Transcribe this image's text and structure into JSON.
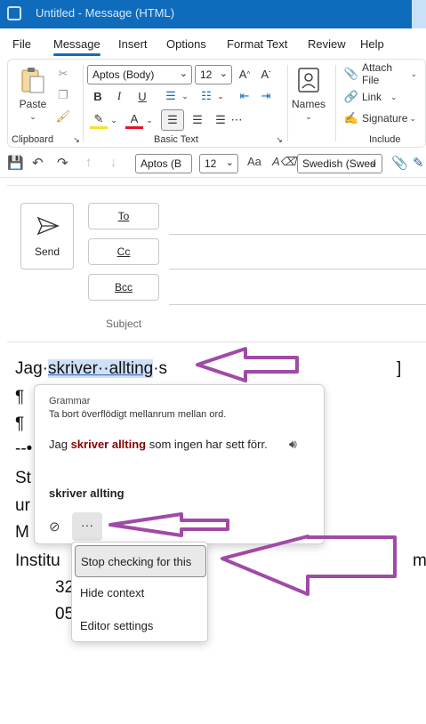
{
  "titlebar": {
    "title": "Untitled  -  Message (HTML)"
  },
  "tabs": [
    "File",
    "Message",
    "Insert",
    "Options",
    "Format Text",
    "Review",
    "Help"
  ],
  "active_tab": "Message",
  "ribbon": {
    "clipboard": {
      "paste": "Paste",
      "label": "Clipboard"
    },
    "basic_text": {
      "font": "Aptos (Body)",
      "size": "12",
      "label": "Basic Text"
    },
    "names": {
      "label": "Names"
    },
    "include": {
      "attach": "Attach File",
      "link": "Link",
      "signature": "Signature",
      "label": "Include"
    }
  },
  "qat": {
    "font": "Aptos (B",
    "size": "12",
    "language": "Swedish (Swed"
  },
  "compose": {
    "send": "Send",
    "to": "To",
    "cc": "Cc",
    "bcc": "Bcc",
    "subject": "Subject"
  },
  "body": {
    "line1_pre": "Jag·",
    "line1_hl": "skriver··allting",
    "line1_post": "·s",
    "line1_right": "]",
    "fragments": [
      "¶",
      "¶",
      "--•",
      "St",
      "ur",
      "M",
      "Institu",
      "32",
      "05"
    ],
    "right_fragment": "m"
  },
  "grammar_popup": {
    "title": "Grammar",
    "description": "Ta bort överflödigt mellanrum mellan ord.",
    "context_pre": "Jag ",
    "context_err": "skriver  allting",
    "context_post": " som ingen har sett förr.",
    "suggestion": "skriver allting",
    "more": "···"
  },
  "menu": {
    "items": [
      "Stop checking for this",
      "Hide context",
      "Editor settings"
    ]
  },
  "colors": {
    "accent": "#0f6cbd",
    "error": "#8b0000",
    "annotation_arrow": "#a04aa8"
  }
}
